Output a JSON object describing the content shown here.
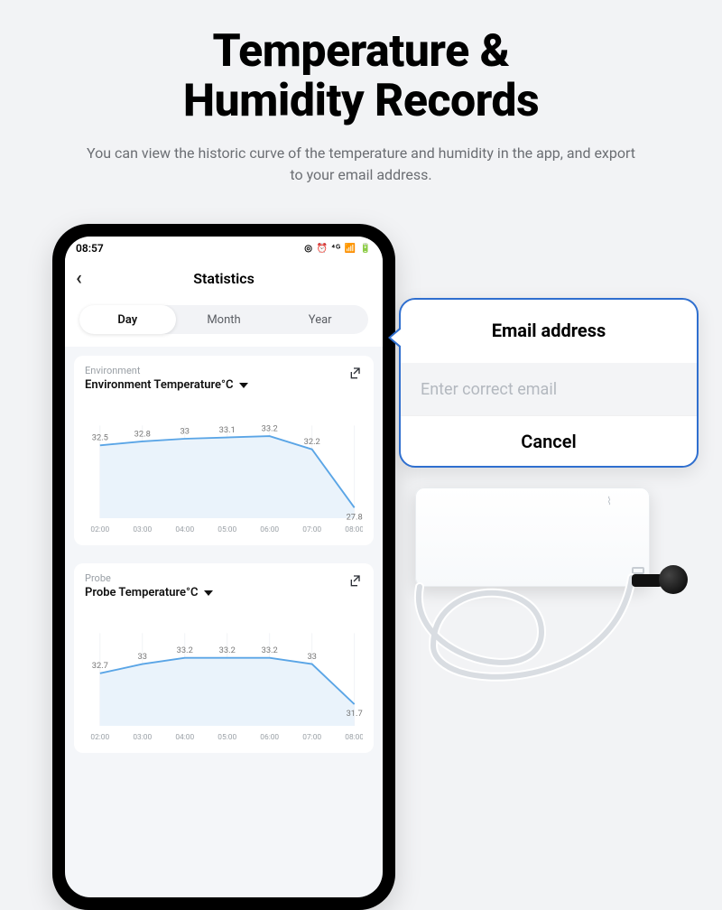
{
  "hero": {
    "title_line1": "Temperature &",
    "title_line2": "Humidity Records",
    "subtitle": "You can view the historic curve of the temperature and  humidity in the app, and export to your email address."
  },
  "status_bar": {
    "time": "08:57",
    "indicators": "◎ ⏰ ⁴ᴳ 📶 🔋"
  },
  "app": {
    "header_title": "Statistics",
    "tabs": {
      "day": "Day",
      "month": "Month",
      "year": "Year"
    },
    "env": {
      "eyebrow": "Environment",
      "metric_label": "Environment Temperature°C"
    },
    "probe": {
      "eyebrow": "Probe",
      "metric_label": "Probe Temperature°C"
    }
  },
  "popup": {
    "title": "Email address",
    "placeholder": "Enter correct email",
    "cancel": "Cancel"
  },
  "chart_data": [
    {
      "type": "line",
      "title": "Environment Temperature°C",
      "x": [
        "02:00",
        "03:00",
        "04:00",
        "05:00",
        "06:00",
        "07:00",
        "08:00"
      ],
      "values": [
        32.5,
        32.8,
        33,
        33.1,
        33.2,
        32.2,
        27.8
      ],
      "xlabel": "",
      "ylabel": "",
      "ylim": [
        27,
        34
      ]
    },
    {
      "type": "line",
      "title": "Probe Temperature°C",
      "x": [
        "02:00",
        "03:00",
        "04:00",
        "05:00",
        "06:00",
        "07:00",
        "08:00"
      ],
      "values": [
        32.7,
        33,
        33.2,
        33.2,
        33.2,
        33,
        31.7
      ],
      "xlabel": "",
      "ylabel": "",
      "ylim": [
        31,
        34
      ]
    }
  ]
}
